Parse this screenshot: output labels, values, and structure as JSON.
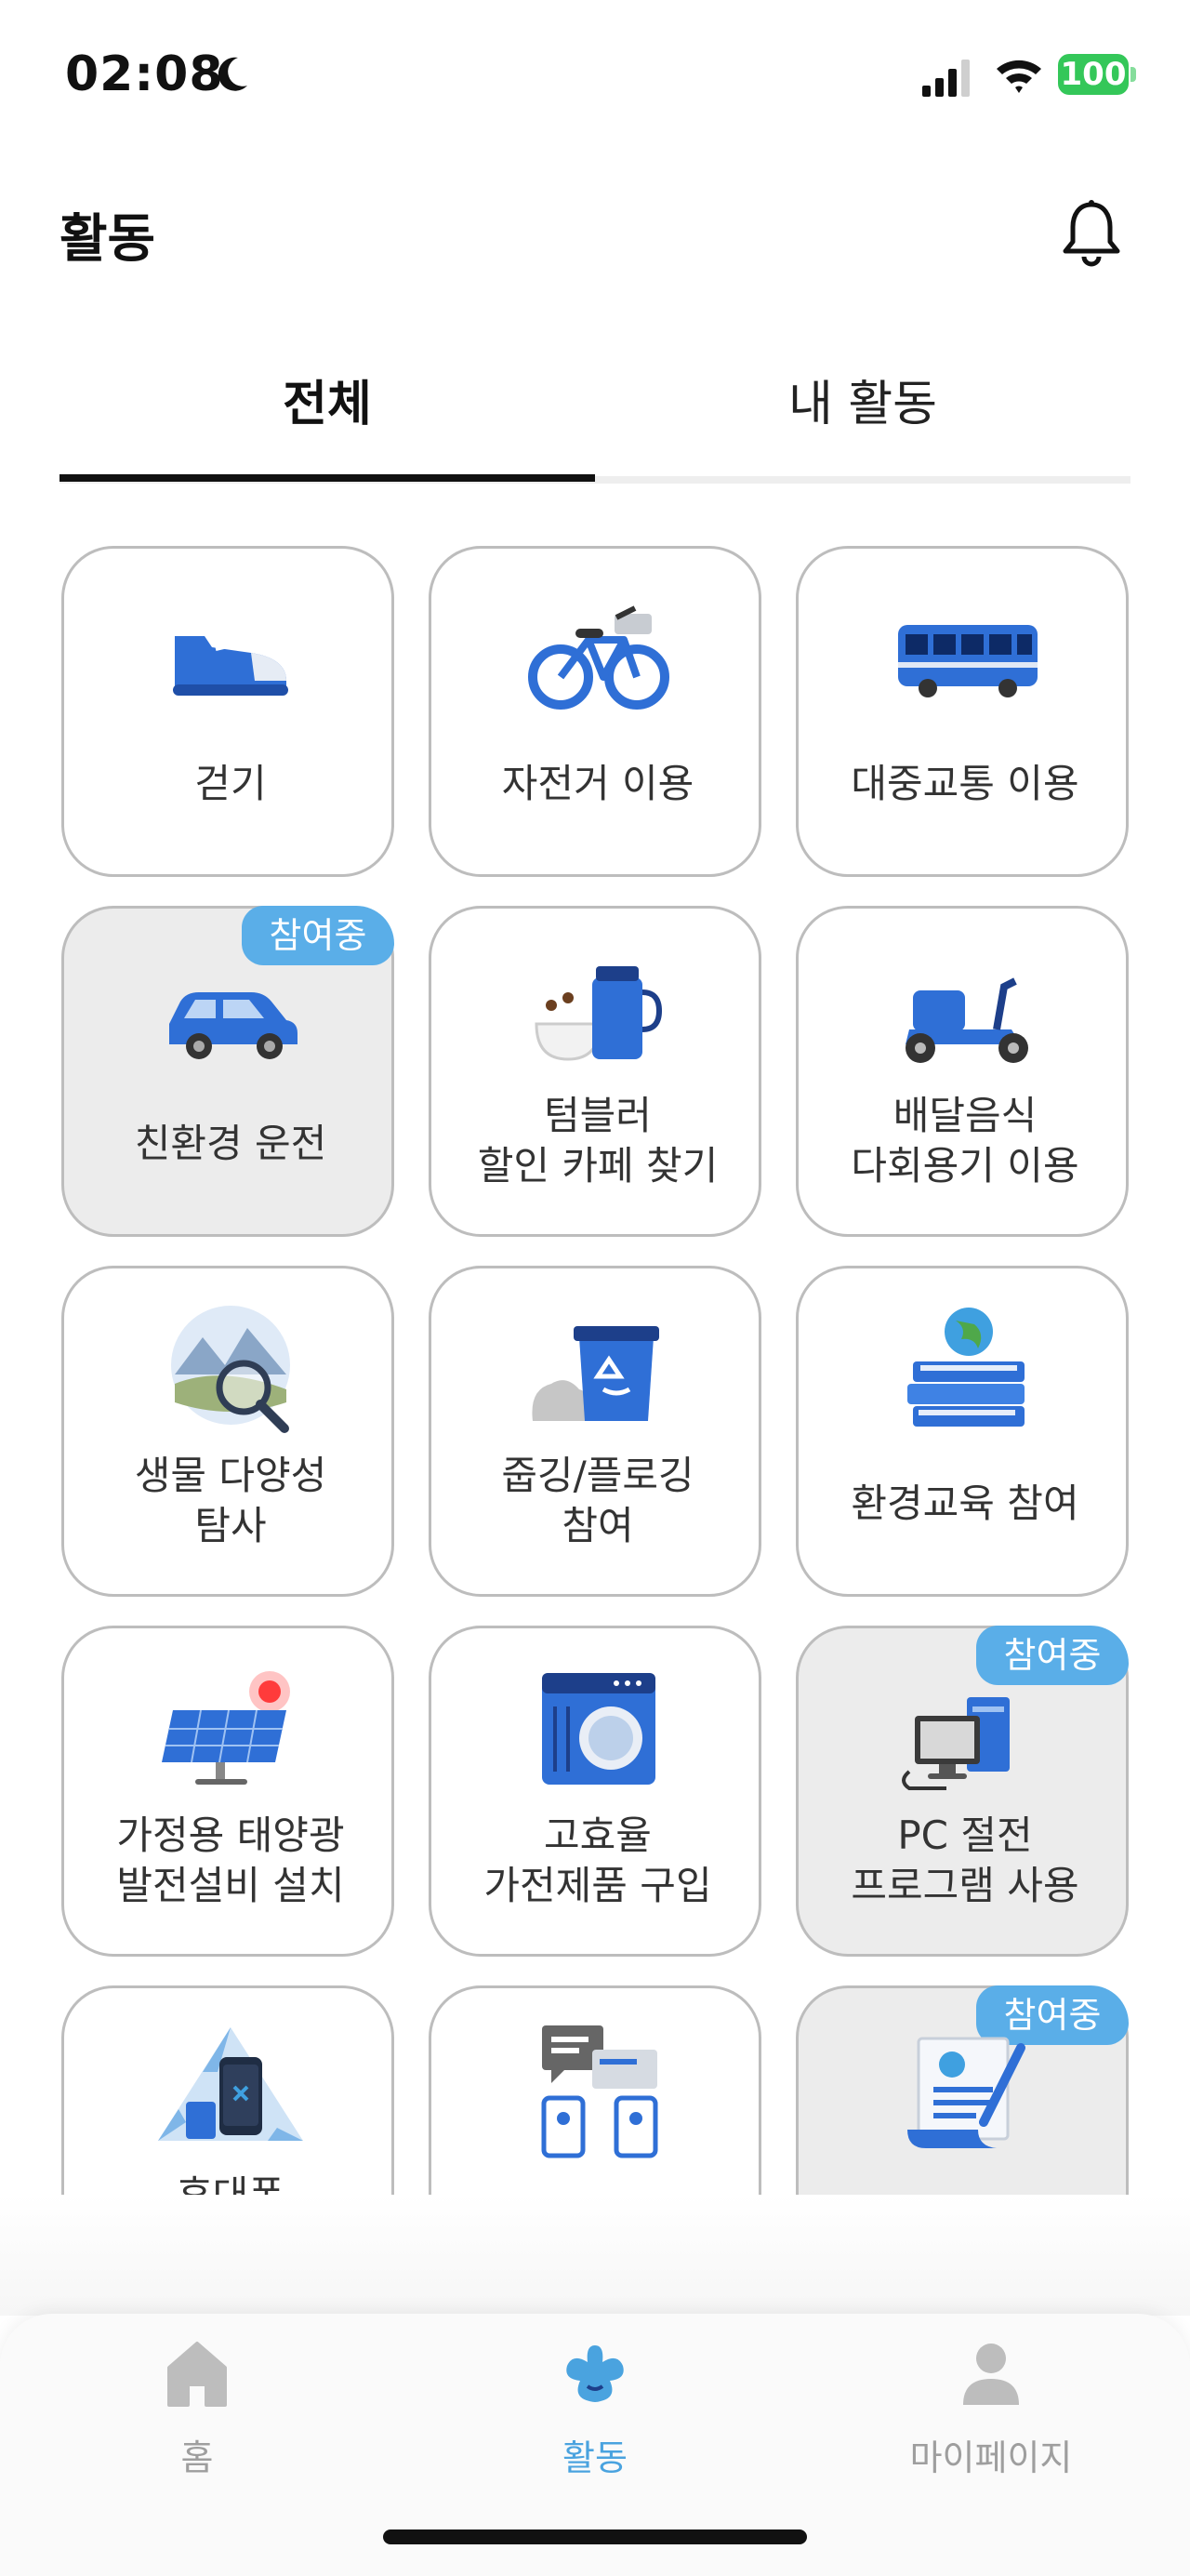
{
  "status_bar": {
    "time": "02:08",
    "battery": "100"
  },
  "header": {
    "title": "활동"
  },
  "tabs": [
    {
      "label": "전체"
    },
    {
      "label": "내 활동"
    }
  ],
  "joined_badge": "참여중",
  "activities": [
    {
      "lines": [
        "걷기"
      ],
      "joined": false,
      "icon": "shoe-icon"
    },
    {
      "lines": [
        "자전거 이용"
      ],
      "joined": false,
      "icon": "bicycle-icon"
    },
    {
      "lines": [
        "대중교통 이용"
      ],
      "joined": false,
      "icon": "bus-icon"
    },
    {
      "lines": [
        "친환경 운전"
      ],
      "joined": true,
      "icon": "car-icon"
    },
    {
      "lines": [
        "텀블러",
        "할인 카페 찾기"
      ],
      "joined": false,
      "icon": "tumbler-icon"
    },
    {
      "lines": [
        "배달음식",
        "다회용기 이용"
      ],
      "joined": false,
      "icon": "scooter-icon"
    },
    {
      "lines": [
        "생물 다양성",
        "탐사"
      ],
      "joined": false,
      "icon": "magnifier-nature-icon"
    },
    {
      "lines": [
        "줍깅/플로깅",
        "참여"
      ],
      "joined": false,
      "icon": "recycle-bin-icon"
    },
    {
      "lines": [
        "환경교육 참여"
      ],
      "joined": false,
      "icon": "books-globe-icon"
    },
    {
      "lines": [
        "가정용 태양광",
        "발전설비 설치"
      ],
      "joined": false,
      "icon": "solar-panel-icon"
    },
    {
      "lines": [
        "고효율",
        "가전제품 구입"
      ],
      "joined": false,
      "icon": "washing-machine-icon"
    },
    {
      "lines": [
        "PC 절전",
        "프로그램 사용"
      ],
      "joined": true,
      "icon": "computer-icon"
    },
    {
      "lines": [
        "휴대폰"
      ],
      "joined": false,
      "icon": "phone-recycle-icon"
    },
    {
      "lines": [
        ""
      ],
      "joined": false,
      "icon": "chat-phones-icon"
    },
    {
      "lines": [
        ""
      ],
      "joined": true,
      "icon": "document-globe-icon"
    }
  ],
  "bottom_nav": [
    {
      "label": "홈",
      "icon": "home-icon",
      "active": false
    },
    {
      "label": "활동",
      "icon": "activity-icon",
      "active": true
    },
    {
      "label": "마이페이지",
      "icon": "person-icon",
      "active": false
    }
  ],
  "colors": {
    "accent": "#4aa3df",
    "badge": "#5aaee8",
    "icon_blue": "#2f6fd6"
  }
}
